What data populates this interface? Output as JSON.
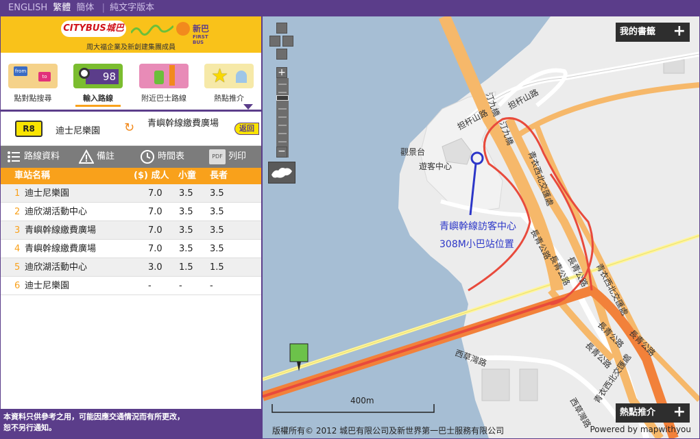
{
  "topbar": {
    "english": "ENGLISH",
    "trad": "繁體",
    "simp": "簡体",
    "text_only": "純文字版本"
  },
  "brand": {
    "citybus": "CITYBUS城巴",
    "firstbus": "新巴",
    "firstbus_en": "FIRST BUS",
    "tagline": "周大福企業及新創建集團成員"
  },
  "tabs": [
    {
      "label": "點對點搜尋",
      "icon": "from-to-icon"
    },
    {
      "label": "輸入路線",
      "icon": "search-route-icon",
      "icon_text": "98"
    },
    {
      "label": "附近巴士路線",
      "icon": "bus-stop-icon"
    },
    {
      "label": "熱點推介",
      "icon": "hotspot-icon"
    }
  ],
  "route": {
    "number": "R8",
    "from": "迪士尼樂園",
    "to": "青嶼幹線繳費廣場",
    "back": "返回"
  },
  "toolbar": {
    "info": "路線資料",
    "notes": "備註",
    "timetable": "時間表",
    "print": "列印",
    "pdf": "PDF"
  },
  "table": {
    "headers": {
      "stop": "車站名稱",
      "adult": "($) 成人",
      "child": "小童",
      "senior": "長者"
    },
    "rows": [
      {
        "n": "1",
        "name": "迪士尼樂園",
        "adult": "7.0",
        "child": "3.5",
        "senior": "3.5"
      },
      {
        "n": "2",
        "name": "迪欣湖活動中心",
        "adult": "7.0",
        "child": "3.5",
        "senior": "3.5"
      },
      {
        "n": "3",
        "name": "青嶼幹線繳費廣場",
        "adult": "7.0",
        "child": "3.5",
        "senior": "3.5"
      },
      {
        "n": "4",
        "name": "青嶼幹線繳費廣場",
        "adult": "7.0",
        "child": "3.5",
        "senior": "3.5"
      },
      {
        "n": "5",
        "name": "迪欣湖活動中心",
        "adult": "3.0",
        "child": "1.5",
        "senior": "1.5"
      },
      {
        "n": "6",
        "name": "迪士尼樂園",
        "adult": "-",
        "child": "-",
        "senior": "-"
      }
    ]
  },
  "footer": {
    "line1": "本資料只供參考之用，可能因應交通情況而有所更改，",
    "line2": "恕不另行通知。"
  },
  "map": {
    "bookmarks": "我的書籤",
    "hotspots": "熱點推介",
    "scale": "400m",
    "copyright": "版權所有© 2012 城巴有限公司及新世界第一巴士服務有限公司",
    "powered": "Powered by mapwithyou",
    "annotation_line1": "青嶼幹線訪客中心",
    "annotation_line2": "308M小巴站位置",
    "labels": {
      "tam_kon_shan_rd_1": "担杆山路",
      "tam_kon_shan_rd_2": "担杆山路",
      "ting_kau_bridge_1": "汀九橋",
      "ting_kau_bridge_2": "汀九橋",
      "viewing_point": "觀景台",
      "visitor_centre": "遊客中心",
      "tsing_yi_north_1": "青衣西北交匯處",
      "tsing_yi_north_2": "青衣西北交匯處",
      "tsing_yi_north_3": "青衣西北交匯處",
      "cheung_tsing_1": "長青公路",
      "cheung_tsing_2": "長青公路",
      "cheung_tsing_3": "長青公路",
      "cheung_tsing_4": "長青公路",
      "cheung_tsing_5": "長青公路",
      "cheung_tsing_6": "長青公路",
      "sai_tso_wan_1": "西草灣路",
      "sai_tso_wan_2": "西草灣路"
    }
  }
}
